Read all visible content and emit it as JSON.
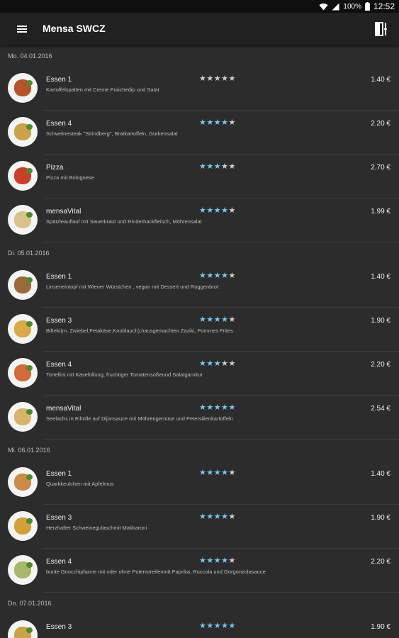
{
  "status": {
    "battery_pct": "100%",
    "time": "12:52"
  },
  "app": {
    "title": "Mensa SWCZ"
  },
  "colors": {
    "star_filled": "#79c6ee",
    "star_empty": "#cfcfcf"
  },
  "days": [
    {
      "date": "Mo. 04.01.2016",
      "items": [
        {
          "name": "Essen 1",
          "desc": "Kartoffelspalten mit Creme Fraichedip und Salat",
          "rating": 5,
          "rated": false,
          "price": "1.40 €",
          "food_color": "#b5532a"
        },
        {
          "name": "Essen 4",
          "desc": "Schweinesteak \"Strindberg\", Bratkartoffeln, Gurkensalat",
          "rating": 4,
          "rated": true,
          "price": "2.20 €",
          "food_color": "#c9a24a"
        },
        {
          "name": "Pizza",
          "desc": "Pizza mit Bolognese",
          "rating": 3,
          "rated": true,
          "price": "2.70 €",
          "food_color": "#c8402a"
        },
        {
          "name": "mensaVital",
          "desc": "Spätzleauflauf mit Sauerkraut und Rinderhackfleisch, Möhrensalat",
          "rating": 4,
          "rated": true,
          "price": "1.99 €",
          "food_color": "#d8c48a"
        }
      ]
    },
    {
      "date": "Di. 05.01.2016",
      "items": [
        {
          "name": "Essen 1",
          "desc": "Linseneintopf mit Wiener Würstchen , vegan mit Dessert und Roggenbrot",
          "rating": 4,
          "rated": true,
          "price": "1.40 €",
          "food_color": "#9a6a3a"
        },
        {
          "name": "Essen 3",
          "desc": "Bifteki(m. Zwiebel,Fetakäse,Knoblauch),hausgemachten Zaziki, Pommes Frites",
          "rating": 4,
          "rated": true,
          "price": "1.90 €",
          "food_color": "#d9a94a"
        },
        {
          "name": "Essen 4",
          "desc": "Tortellini mit Käsefüllung, fruchtiger Tomatensoßeund Salatgarnitur",
          "rating": 3,
          "rated": true,
          "price": "2.20 €",
          "food_color": "#d36a3a"
        },
        {
          "name": "mensaVital",
          "desc": "Seelachs in Eihülle auf Dijonsauce mit Möhrengemüse und Petersilienkartoffeln",
          "rating": 5,
          "rated": true,
          "price": "2.54 €",
          "food_color": "#d8b46a"
        }
      ]
    },
    {
      "date": "Mi. 06.01.2016",
      "items": [
        {
          "name": "Essen 1",
          "desc": "Quarkkeulchen mit Apfelmus",
          "rating": 4,
          "rated": true,
          "price": "1.40 €",
          "food_color": "#c98a4a"
        },
        {
          "name": "Essen 3",
          "desc": "Herzhafter Schweinegulaschmit Makkaroni",
          "rating": 4,
          "rated": true,
          "price": "1.90 €",
          "food_color": "#d4a03a"
        },
        {
          "name": "Essen 4",
          "desc": "bunte Gnocchipfanne mit oder ohne Putenstreifenmit Paprika, Ruccola und Gorgonzolasauce",
          "rating": 4,
          "rated": true,
          "price": "2.20 €",
          "food_color": "#a8b86a"
        }
      ]
    },
    {
      "date": "Do. 07.01.2016",
      "items": [
        {
          "name": "Essen 3",
          "desc": "",
          "rating": 5,
          "rated": true,
          "price": "1.90 €",
          "food_color": "#c9a24a"
        }
      ]
    }
  ]
}
